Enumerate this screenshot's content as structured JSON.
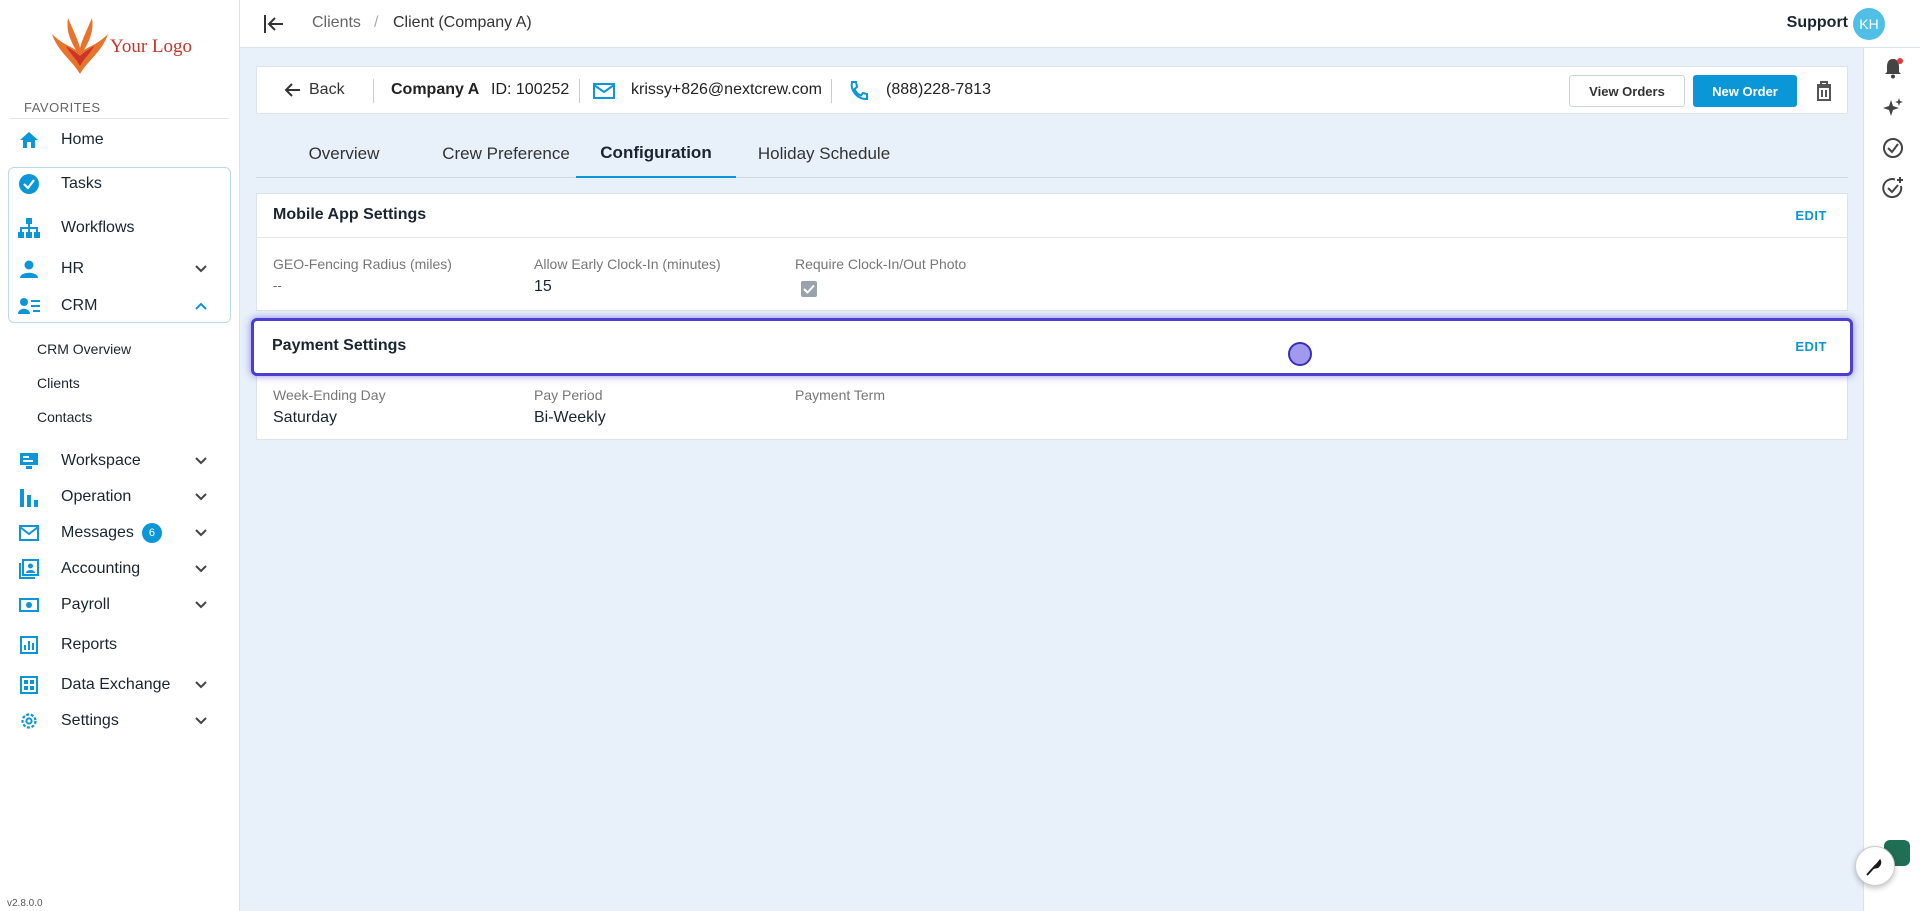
{
  "logo": {
    "text": "Your Logo"
  },
  "sidebar": {
    "favorites_label": "FAVORITES",
    "items": [
      {
        "label": "Home",
        "icon": "home-icon"
      },
      {
        "label": "Tasks",
        "icon": "check-circle-icon"
      },
      {
        "label": "Workflows",
        "icon": "hierarchy-icon"
      },
      {
        "label": "HR",
        "icon": "person-icon"
      },
      {
        "label": "CRM",
        "icon": "contacts-icon"
      },
      {
        "label": "Workspace",
        "icon": "monitor-icon"
      },
      {
        "label": "Operation",
        "icon": "bar-chart-icon"
      },
      {
        "label": "Messages",
        "icon": "mail-icon",
        "badge": "6"
      },
      {
        "label": "Accounting",
        "icon": "ledger-icon"
      },
      {
        "label": "Payroll",
        "icon": "money-icon"
      },
      {
        "label": "Reports",
        "icon": "report-icon"
      },
      {
        "label": "Data Exchange",
        "icon": "grid-icon"
      },
      {
        "label": "Settings",
        "icon": "gear-icon"
      }
    ],
    "crm_sub": [
      "CRM Overview",
      "Clients",
      "Contacts"
    ],
    "version": "v2.8.0.0"
  },
  "topbar": {
    "breadcrumb_1": "Clients",
    "breadcrumb_sep": "/",
    "breadcrumb_2": "Client (Company A)",
    "support": "Support",
    "avatar": "KH"
  },
  "header": {
    "back": "Back",
    "company": "Company A",
    "id": "ID: 100252",
    "email": "krissy+826@nextcrew.com",
    "phone": "(888)228-7813",
    "view_orders": "View Orders",
    "new_order": "New Order"
  },
  "tabs": [
    "Overview",
    "Crew Preference",
    "Configuration",
    "Holiday Schedule"
  ],
  "active_tab": "Configuration",
  "mobile_app": {
    "title": "Mobile App Settings",
    "edit": "EDIT",
    "geo_label": "GEO-Fencing Radius (miles)",
    "geo_value": "--",
    "early_label": "Allow Early Clock-In (minutes)",
    "early_value": "15",
    "photo_label": "Require Clock-In/Out Photo",
    "photo_checked": true
  },
  "payment": {
    "title": "Payment Settings",
    "edit": "EDIT",
    "week_label": "Week-Ending Day",
    "week_value": "Saturday",
    "period_label": "Pay Period",
    "period_value": "Bi-Weekly",
    "term_label": "Payment Term",
    "term_value": ""
  },
  "colors": {
    "accent": "#0b96d8",
    "highlight": "#4b3fd3"
  }
}
